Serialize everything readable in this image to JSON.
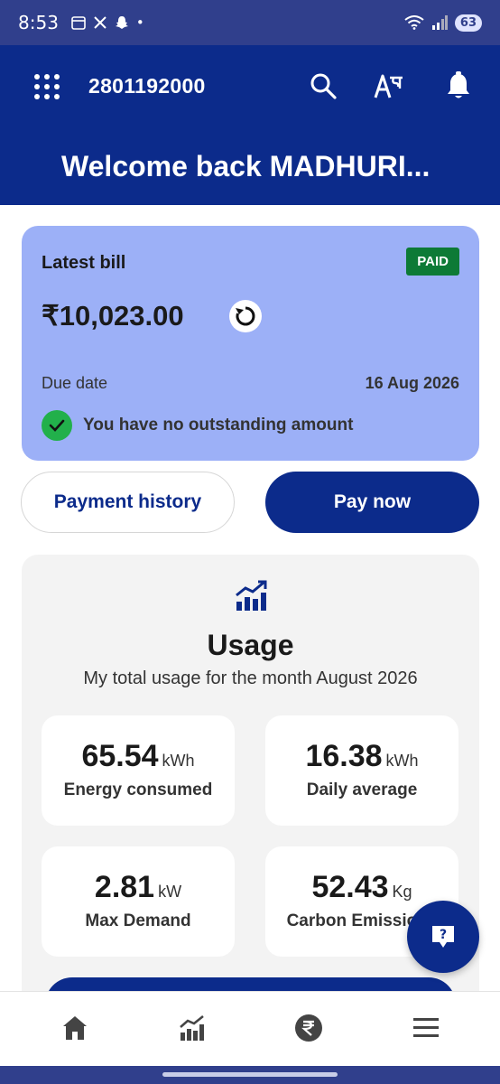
{
  "status_bar": {
    "time": "8:53",
    "notifications": [
      "calendar-icon",
      "x-icon",
      "snapchat-icon",
      "•"
    ],
    "battery": "63"
  },
  "header": {
    "account_number": "2801192000",
    "welcome": "Welcome back MADHURI..."
  },
  "bill": {
    "title": "Latest bill",
    "status": "PAID",
    "amount": "₹10,023.00",
    "due_label": "Due date",
    "due_date": "16 Aug 2026",
    "outstanding_message": "You have no outstanding amount"
  },
  "actions": {
    "payment_history": "Payment history",
    "pay_now": "Pay now"
  },
  "usage": {
    "title": "Usage",
    "subtitle": "My total usage for the month August 2026",
    "stats": [
      {
        "value": "65.54",
        "unit": "kWh",
        "label": "Energy consumed"
      },
      {
        "value": "16.38",
        "unit": "kWh",
        "label": "Daily average"
      },
      {
        "value": "2.81",
        "unit": "kW",
        "label": "Max Demand"
      },
      {
        "value": "52.43",
        "unit": "Kg",
        "label": "Carbon Emissions"
      }
    ]
  },
  "colors": {
    "primary": "#0c2b8b",
    "bill_card": "#9cb0f7",
    "paid_badge": "#0d7a36",
    "success": "#22b04b"
  },
  "bottom_nav": [
    "home-icon",
    "usage-chart-icon",
    "rupee-icon",
    "menu-icon"
  ]
}
